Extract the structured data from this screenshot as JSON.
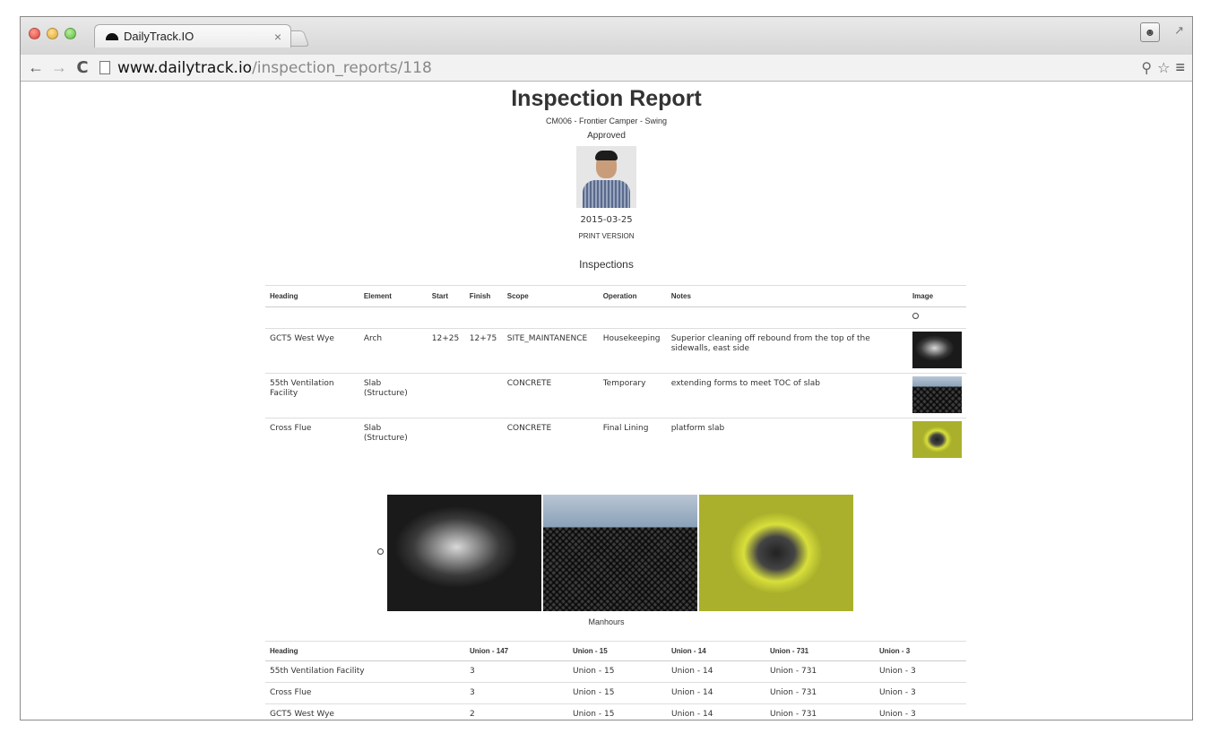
{
  "browser": {
    "tab_title": "DailyTrack.IO",
    "tab_close": "×",
    "url_host": "www.dailytrack.io",
    "url_path": "/inspection_reports/118"
  },
  "report": {
    "title": "Inspection Report",
    "subtitle": "CM006 - Frontier Camper - Swing",
    "status": "Approved",
    "date": "2015-03-25",
    "print_link": "PRINT VERSION"
  },
  "inspections": {
    "title": "Inspections",
    "columns": [
      "Heading",
      "Element",
      "Start",
      "Finish",
      "Scope",
      "Operation",
      "Notes",
      "Image"
    ],
    "rows": [
      {
        "heading": "GCT5 West Wye",
        "element": "Arch",
        "start": "12+25",
        "finish": "12+75",
        "scope": "SITE_MAINTANENCE",
        "operation": "Housekeeping",
        "notes": "Superior cleaning off rebound from the top of the sidewalls, east side",
        "image": "tunnel-arch-photo"
      },
      {
        "heading": "55th Ventilation Facility",
        "element": "Slab (Structure)",
        "start": "",
        "finish": "",
        "scope": "CONCRETE",
        "operation": "Temporary",
        "notes": "extending forms to meet TOC of slab",
        "image": "rebar-slab-photo"
      },
      {
        "heading": "Cross Flue",
        "element": "Slab (Structure)",
        "start": "",
        "finish": "",
        "scope": "CONCRETE",
        "operation": "Final Lining",
        "notes": "platform slab",
        "image": "cross-flue-photo"
      }
    ]
  },
  "manhours": {
    "title": "Manhours",
    "columns": [
      "Heading",
      "Union - 147",
      "Union - 15",
      "Union - 14",
      "Union - 731",
      "Union - 3"
    ],
    "rows": [
      [
        "55th Ventilation Facility",
        "3",
        "Union - 15",
        "Union - 14",
        "Union - 731",
        "Union - 3"
      ],
      [
        "Cross Flue",
        "3",
        "Union - 15",
        "Union - 14",
        "Union - 731",
        "Union - 3"
      ],
      [
        "GCT5 West Wye",
        "2",
        "Union - 15",
        "Union - 14",
        "Union - 731",
        "Union - 3"
      ]
    ]
  },
  "colors": {
    "frame_border": "#8a8a8a",
    "text": "#333333",
    "rule": "#dddddd",
    "flue_yellow": "#d8df3b"
  }
}
